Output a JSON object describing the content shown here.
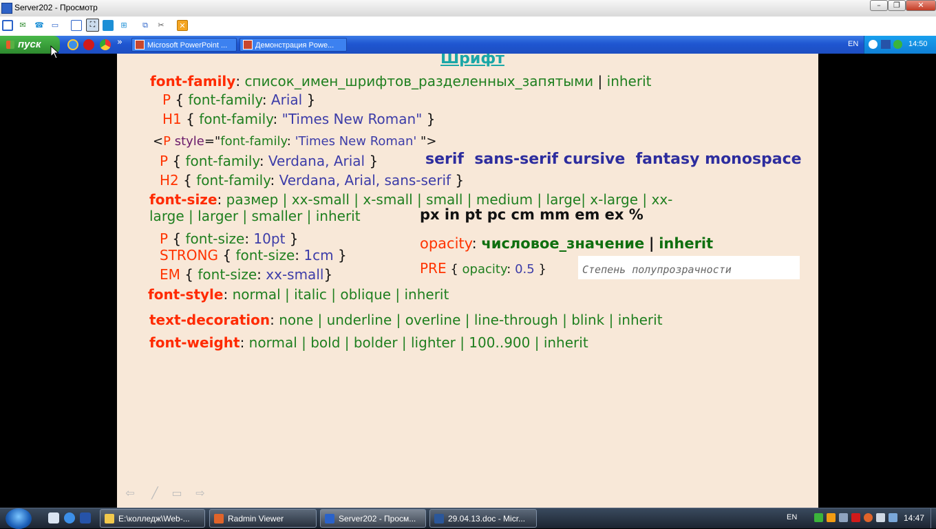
{
  "window": {
    "title": "Server202 - Просмотр"
  },
  "xp_taskbar": {
    "start_label": "пуск",
    "tasks": [
      "Microsoft PowerPoint ...",
      "Демонстрация Powe..."
    ],
    "lang": "EN",
    "clock": "14:50",
    "overflow": "»"
  },
  "slide": {
    "title": "Шрифт",
    "ff_kw": "font-family",
    "ff_colon": ":",
    "ff_desc": "список_имен_шрифтов_разделенных_запятыми",
    "sep": "|",
    "inherit": "inherit",
    "p_sel": "P",
    "h1_sel": "H1",
    "h2_sel": "H2",
    "strong_sel": "STRONG",
    "em_sel": "EM",
    "pre_sel": "PRE",
    "brace_open": "{",
    "brace_close": "}",
    "prop_ff": "font-family",
    "prop_fs": "font-size",
    "prop_op": "opacity",
    "colon": ":",
    "val_arial": "Arial",
    "val_tnr": "\"Times New Roman\"",
    "inline_open": "<",
    "inline_style": "style",
    "inline_eq": "=\"",
    "inline_val": "'Times New Roman'",
    "inline_close": " \">",
    "val_verdana": "Verdana, Arial",
    "val_verdana_ss": "Verdana, Arial, sans-serif",
    "generic_families": [
      "serif",
      "sans-serif",
      "cursive",
      "fantasy",
      "monospace"
    ],
    "fs_kw": "font-size",
    "fs_values_line1": "размер | xx-small | x-small | small | medium | large| x-large | xx-",
    "fs_values_line2": "large | larger | smaller | inherit",
    "units": "px in pt pc cm mm em ex %",
    "val_10pt": "10pt",
    "val_1cm": "1cm",
    "val_xxsmall": "xx-small",
    "brace_close_tight": "}",
    "opacity_kw": "opacity",
    "opacity_desc": "числовое_значение",
    "opacity_inherit": "inherit",
    "val_05": "0.5",
    "note": "Степень полупрозрачности",
    "fst_kw": "font-style",
    "fst_values": "normal | italic | oblique | inherit",
    "td_kw": "text-decoration",
    "td_values": "none | underline | overline | line-through | blink | inherit",
    "fw_kw": "font-weight",
    "fw_values": "normal | bold | bolder | lighter | 100..900 | inherit"
  },
  "win7_taskbar": {
    "tasks": [
      "E:\\колледж\\Web-...",
      "Radmin Viewer",
      "Server202 - Просм...",
      "29.04.13.doc - Micr..."
    ],
    "lang": "EN",
    "clock": "14:47"
  }
}
